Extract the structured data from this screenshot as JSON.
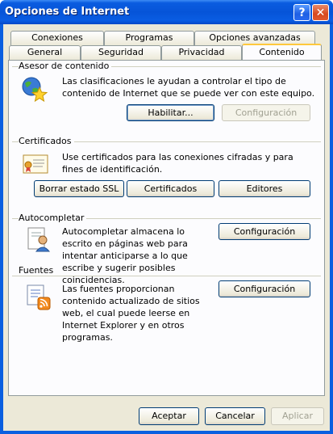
{
  "window": {
    "title": "Opciones de Internet"
  },
  "titlebar": {
    "help_glyph": "?",
    "close_glyph": "✕"
  },
  "tabs": {
    "row_back": [
      "Conexiones",
      "Programas",
      "Opciones avanzadas"
    ],
    "row_front": [
      "General",
      "Seguridad",
      "Privacidad",
      "Contenido"
    ],
    "active": "Contenido"
  },
  "content_advisor": {
    "label": "Asesor de contenido",
    "description": "Las clasificaciones le ayudan a controlar el tipo de contenido de Internet que se puede ver con este equipo.",
    "enable_button": "Habilitar...",
    "settings_button": "Configuración",
    "settings_disabled": true
  },
  "certificates": {
    "label": "Certificados",
    "description": "Use certificados para las conexiones cifradas y para fines de identificación.",
    "clear_ssl_button": "Borrar estado SSL",
    "certificates_button": "Certificados",
    "publishers_button": "Editores"
  },
  "autocomplete": {
    "label": "Autocompletar",
    "description": "Autocompletar almacena lo escrito en páginas web para intentar anticiparse a lo que escribe y sugerir posibles coincidencias.",
    "settings_button": "Configuración"
  },
  "feeds": {
    "label": "Fuentes",
    "description": "Las fuentes proporcionan contenido actualizado de sitios web, el cual puede leerse en Internet Explorer y en otros programas.",
    "settings_button": "Configuración"
  },
  "footer": {
    "ok_button": "Aceptar",
    "cancel_button": "Cancelar",
    "apply_button": "Aplicar",
    "apply_disabled": true
  }
}
